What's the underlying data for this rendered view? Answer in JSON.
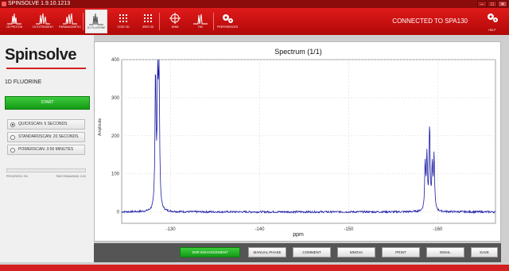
{
  "window": {
    "title": "SPINSOLVE 1.9.10.1213",
    "controls": {
      "minimize": "–",
      "maximize": "□",
      "close": "✕"
    }
  },
  "toolbar": {
    "buttons": [
      {
        "label": "1D PROTON",
        "icon": "spectrum-icon",
        "active": false
      },
      {
        "label": "1D EXTENDED+",
        "icon": "spectrum-icon",
        "active": false
      },
      {
        "label": "PARAMAGNETIC",
        "icon": "spectrum-icon",
        "active": false
      },
      {
        "label": "1D FLUORINE",
        "icon": "spectrum-icon",
        "active": true
      },
      {
        "label": "COSY 2D",
        "icon": "grid-icon",
        "active": false
      },
      {
        "label": "JRES 2D",
        "icon": "grid-icon",
        "active": false
      },
      {
        "label": "SHIM",
        "icon": "target-icon",
        "active": false
      },
      {
        "label": "RM",
        "icon": "spectrum-icon",
        "active": false
      },
      {
        "label": "PREFERENCES",
        "icon": "gears-icon",
        "active": false
      }
    ],
    "status": "CONNECTED TO SPA130",
    "help_label": "HELP"
  },
  "left": {
    "logo": "Spinsolve",
    "method_title": "1D FLUORINE",
    "start_label": "START",
    "scan_options": [
      {
        "label": "QUICKSCAN: 5 SECONDS",
        "selected": true
      },
      {
        "label": "STANDARDSCAN: 20 SECONDS",
        "selected": false
      },
      {
        "label": "POWERSCAN: 3:50 MINUTES",
        "selected": false
      }
    ],
    "progress": {
      "value": 0.0,
      "percent_label": "PROGRESS: 0%",
      "time_label": "TIME REMAINING: 0:00"
    }
  },
  "plot": {
    "title": "Spectrum (1/1)",
    "ylabel": "Amplitude",
    "xlabel": "ppm"
  },
  "chart_data": {
    "type": "line",
    "title": "Spectrum (1/1)",
    "xlabel": "ppm",
    "ylabel": "Amplitude",
    "xlim": [
      -124.5,
      -166.5
    ],
    "ylim": [
      -30,
      400
    ],
    "x_reversed": true,
    "xticks": [
      -130,
      -140,
      -150,
      -160
    ],
    "yticks": [
      0,
      100,
      200,
      300,
      400
    ],
    "grid": true,
    "color": "#1a1aa6",
    "peaks": [
      {
        "x": -128.7,
        "y": 350
      },
      {
        "x": -128.55,
        "y": 340
      },
      {
        "x": -128.3,
        "y": 360
      },
      {
        "x": -159.6,
        "y": 140
      },
      {
        "x": -159.4,
        "y": 110
      },
      {
        "x": -159.1,
        "y": 220
      },
      {
        "x": -158.8,
        "y": 140
      },
      {
        "x": -158.6,
        "y": 120
      }
    ]
  },
  "bottom_buttons": [
    {
      "label": "SNR ENHANCEMENT",
      "style": "green"
    },
    {
      "label": "MANUAL PHASE",
      "style": "normal"
    },
    {
      "label": "COMMENT",
      "style": "normal"
    },
    {
      "label": "MNOVA",
      "style": "normal"
    },
    {
      "label": "PRINT",
      "style": "normal"
    },
    {
      "label": "EMAIL",
      "style": "normal"
    },
    {
      "label": "SAVE",
      "style": "normal"
    }
  ]
}
